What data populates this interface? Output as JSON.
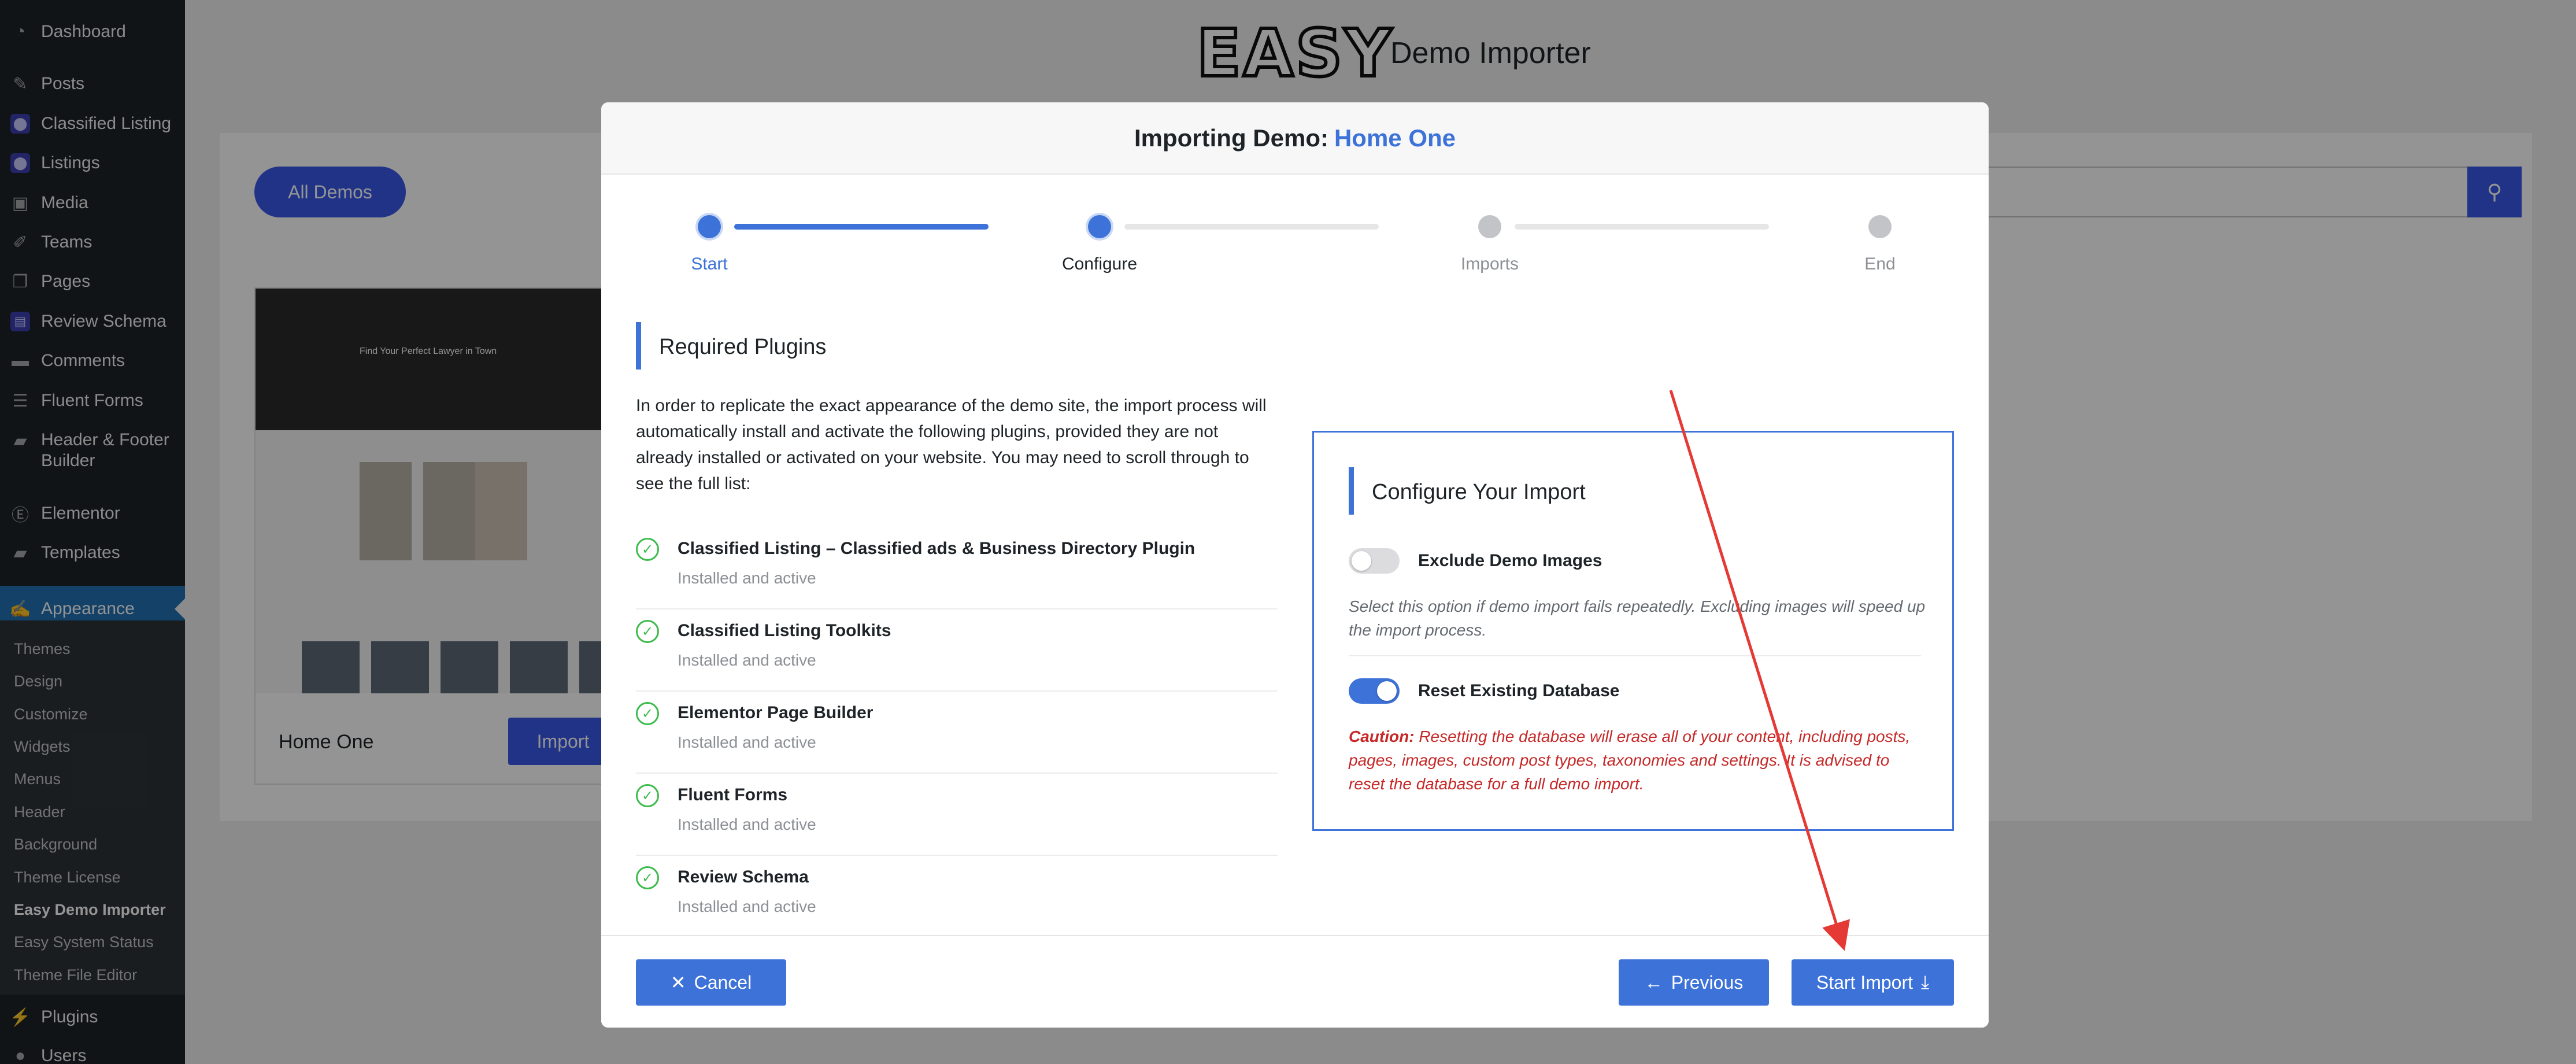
{
  "sidebar": {
    "items": [
      {
        "label": "Dashboard",
        "icon": "dashboard-icon"
      },
      {
        "label": "Posts",
        "icon": "pin-icon"
      },
      {
        "label": "Classified Listing",
        "icon": "location-badge-icon"
      },
      {
        "label": "Listings",
        "icon": "location-badge-icon"
      },
      {
        "label": "Media",
        "icon": "media-icon"
      },
      {
        "label": "Teams",
        "icon": "pen-icon"
      },
      {
        "label": "Pages",
        "icon": "pages-icon"
      },
      {
        "label": "Review Schema",
        "icon": "review-badge-icon"
      },
      {
        "label": "Comments",
        "icon": "comment-icon"
      },
      {
        "label": "Fluent Forms",
        "icon": "forms-icon"
      },
      {
        "label": "Header & Footer Builder",
        "icon": "folder-icon"
      },
      {
        "label": "Elementor",
        "icon": "elementor-icon"
      },
      {
        "label": "Templates",
        "icon": "folder-icon"
      },
      {
        "label": "Appearance",
        "icon": "brush-icon"
      },
      {
        "label": "Plugins",
        "icon": "plug-icon"
      },
      {
        "label": "Users",
        "icon": "user-icon"
      }
    ],
    "appearance_submenu": [
      "Themes",
      "Design",
      "Customize",
      "Widgets",
      "Menus",
      "Header",
      "Background",
      "Theme License",
      "Easy Demo Importer",
      "Easy System Status",
      "Theme File Editor"
    ]
  },
  "header": {
    "logo_text": "EASY",
    "title": "Demo Importer"
  },
  "toolbar": {
    "all_demos_label": "All Demos"
  },
  "demo_card": {
    "name": "Home One",
    "import_label": "Import",
    "thumb_text": "Find Your Perfect Lawyer in Town"
  },
  "modal": {
    "title_prefix": "Importing Demo:",
    "demo_name": "Home One",
    "steps": [
      "Start",
      "Configure",
      "Imports",
      "End"
    ],
    "required_plugins": {
      "heading": "Required Plugins",
      "intro": "In order to replicate the exact appearance of the demo site, the import process will automatically install and activate the following plugins, provided they are not already installed or activated on your website. You may need to scroll through to see the full list:",
      "items": [
        {
          "name": "Classified Listing – Classified ads & Business Directory Plugin",
          "status": "Installed and active"
        },
        {
          "name": "Classified Listing Toolkits",
          "status": "Installed and active"
        },
        {
          "name": "Elementor Page Builder",
          "status": "Installed and active"
        },
        {
          "name": "Fluent Forms",
          "status": "Installed and active"
        },
        {
          "name": "Review Schema",
          "status": "Installed and active"
        }
      ]
    },
    "configure": {
      "heading": "Configure Your Import",
      "exclude_images_label": "Exclude Demo Images",
      "exclude_images_desc": "Select this option if demo import fails repeatedly. Excluding images will speed up the import process.",
      "exclude_images_on": false,
      "reset_db_label": "Reset Existing Database",
      "reset_db_on": true,
      "caution_label": "Caution:",
      "caution_text": "Resetting the database will erase all of your content, including posts, pages, images, custom post types, taxonomies and settings. It is advised to reset the database for a full demo import."
    },
    "footer": {
      "cancel_label": "Cancel",
      "previous_label": "Previous",
      "start_import_label": "Start Import"
    }
  },
  "colors": {
    "accent": "#3d72d9",
    "sidebar_bg": "#1d2327",
    "caution": "#c62828",
    "check": "#3dbb4c",
    "annotation_arrow": "#e53935"
  }
}
